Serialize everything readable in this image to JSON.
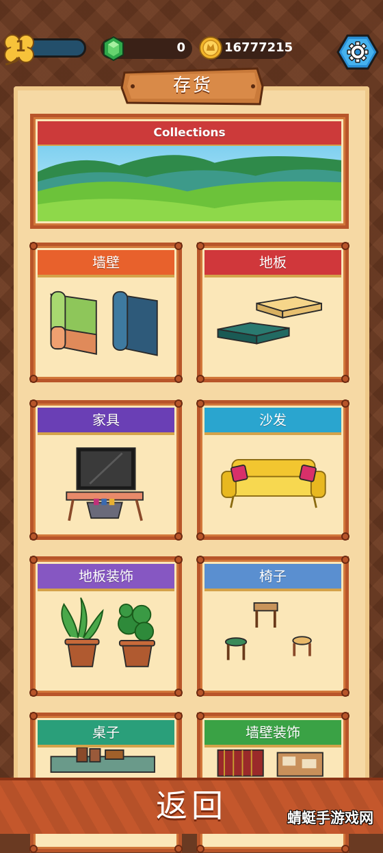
{
  "hud": {
    "level": "1",
    "level_progress": 0.0,
    "gems": "0",
    "coins": "16777215"
  },
  "title": "存货",
  "banner": {
    "label": "Collections",
    "color": "#cc3a3a"
  },
  "categories": [
    {
      "label": "墙壁",
      "color": "#e8612c",
      "icon": "wall-rolls-icon"
    },
    {
      "label": "地板",
      "color": "#d0373b",
      "icon": "floor-tiles-icon"
    },
    {
      "label": "家具",
      "color": "#6a3fb5",
      "icon": "tv-stand-icon"
    },
    {
      "label": "沙发",
      "color": "#2aa5cf",
      "icon": "sofa-icon"
    },
    {
      "label": "地板装饰",
      "color": "#8657c2",
      "icon": "potted-plants-icon"
    },
    {
      "label": "椅子",
      "color": "#5a8fd0",
      "icon": "stools-icon"
    },
    {
      "label": "桌子",
      "color": "#2a9f7a",
      "icon": "table-icon"
    },
    {
      "label": "墙壁装饰",
      "color": "#3aa245",
      "icon": "wall-decor-icon"
    }
  ],
  "back_label": "返回",
  "watermark": "蜻蜓手游戏网"
}
